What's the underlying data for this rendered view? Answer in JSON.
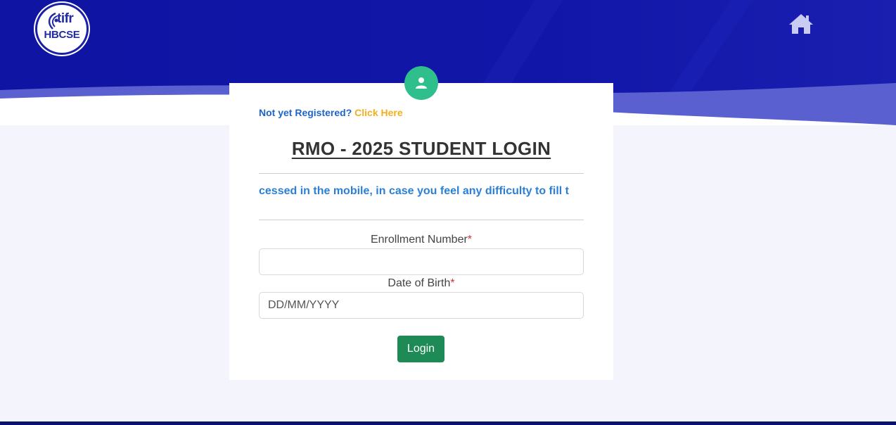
{
  "header": {
    "logo_top": "tifr",
    "logo_bottom": "HBCSE",
    "home_icon": "home-icon"
  },
  "card": {
    "badge_icon": "user-icon",
    "register_prompt": "Not yet Registered?",
    "register_link": "Click Here",
    "title": "RMO - 2025 STUDENT LOGIN",
    "marquee": "cessed in the mobile, in case you feel any difficulty to fill t",
    "enrollment_label": "Enrollment Number",
    "dob_label": "Date of Birth",
    "required_mark": "*",
    "enrollment_value": "",
    "dob_placeholder": "DD/MM/YYYY",
    "login_label": "Login"
  },
  "colors": {
    "header_blue": "#1419a6",
    "accent_green": "#2fbf8d",
    "button_green": "#1e8a55",
    "link_blue": "#1f64c8",
    "link_yellow": "#f2b01e"
  }
}
